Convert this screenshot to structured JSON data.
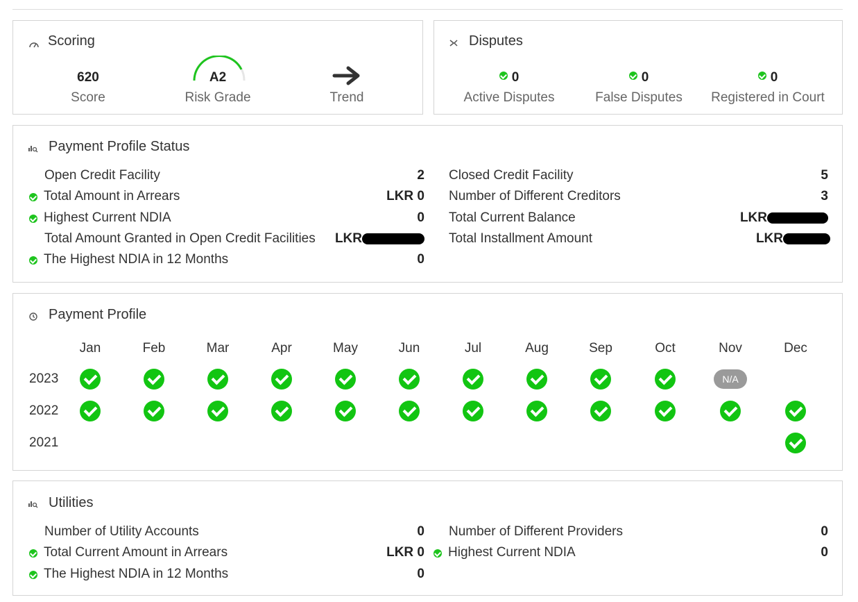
{
  "scoring": {
    "title": "Scoring",
    "score_value": "620",
    "score_label": "Score",
    "risk_grade_value": "A2",
    "risk_grade_label": "Risk Grade",
    "trend_label": "Trend"
  },
  "disputes": {
    "title": "Disputes",
    "items": [
      {
        "value": "0",
        "label": "Active Disputes"
      },
      {
        "value": "0",
        "label": "False Disputes"
      },
      {
        "value": "0",
        "label": "Registered in Court"
      }
    ]
  },
  "payment_profile_status": {
    "title": "Payment Profile Status",
    "left": [
      {
        "label": "Open Credit Facility",
        "value": "2",
        "check": false
      },
      {
        "label": "Total Amount in Arrears",
        "value": "LKR 0",
        "check": true
      },
      {
        "label": "Highest Current NDIA",
        "value": "0",
        "check": true
      },
      {
        "label": "Total Amount Granted in Open Credit Facilities",
        "value": "LKR",
        "check": false,
        "redacted": true
      },
      {
        "label": "The Highest NDIA in 12 Months",
        "value": "0",
        "check": true
      }
    ],
    "right": [
      {
        "label": "Closed Credit Facility",
        "value": "5"
      },
      {
        "label": "Number of Different Creditors",
        "value": "3"
      },
      {
        "label": "Total Current Balance",
        "value": "LKR",
        "redacted": true
      },
      {
        "label": "Total Installment Amount",
        "value": "LKR",
        "redacted": true
      }
    ]
  },
  "payment_profile": {
    "title": "Payment Profile",
    "months": [
      "Jan",
      "Feb",
      "Mar",
      "Apr",
      "May",
      "Jun",
      "Jul",
      "Aug",
      "Sep",
      "Oct",
      "Nov",
      "Dec"
    ],
    "years": [
      "2023",
      "2022",
      "2021"
    ],
    "na_label": "N/A",
    "status_color": "#12c512"
  },
  "utilities": {
    "title": "Utilities",
    "left": [
      {
        "label": "Number of Utility Accounts",
        "value": "0",
        "check": false
      },
      {
        "label": "Total Current Amount in Arrears",
        "value": "LKR 0",
        "check": true
      },
      {
        "label": "The Highest NDIA in 12 Months",
        "value": "0",
        "check": true
      }
    ],
    "right": [
      {
        "label": "Number of Different Providers",
        "value": "0",
        "check": false
      },
      {
        "label": "Highest Current NDIA",
        "value": "0",
        "check": true
      }
    ]
  }
}
